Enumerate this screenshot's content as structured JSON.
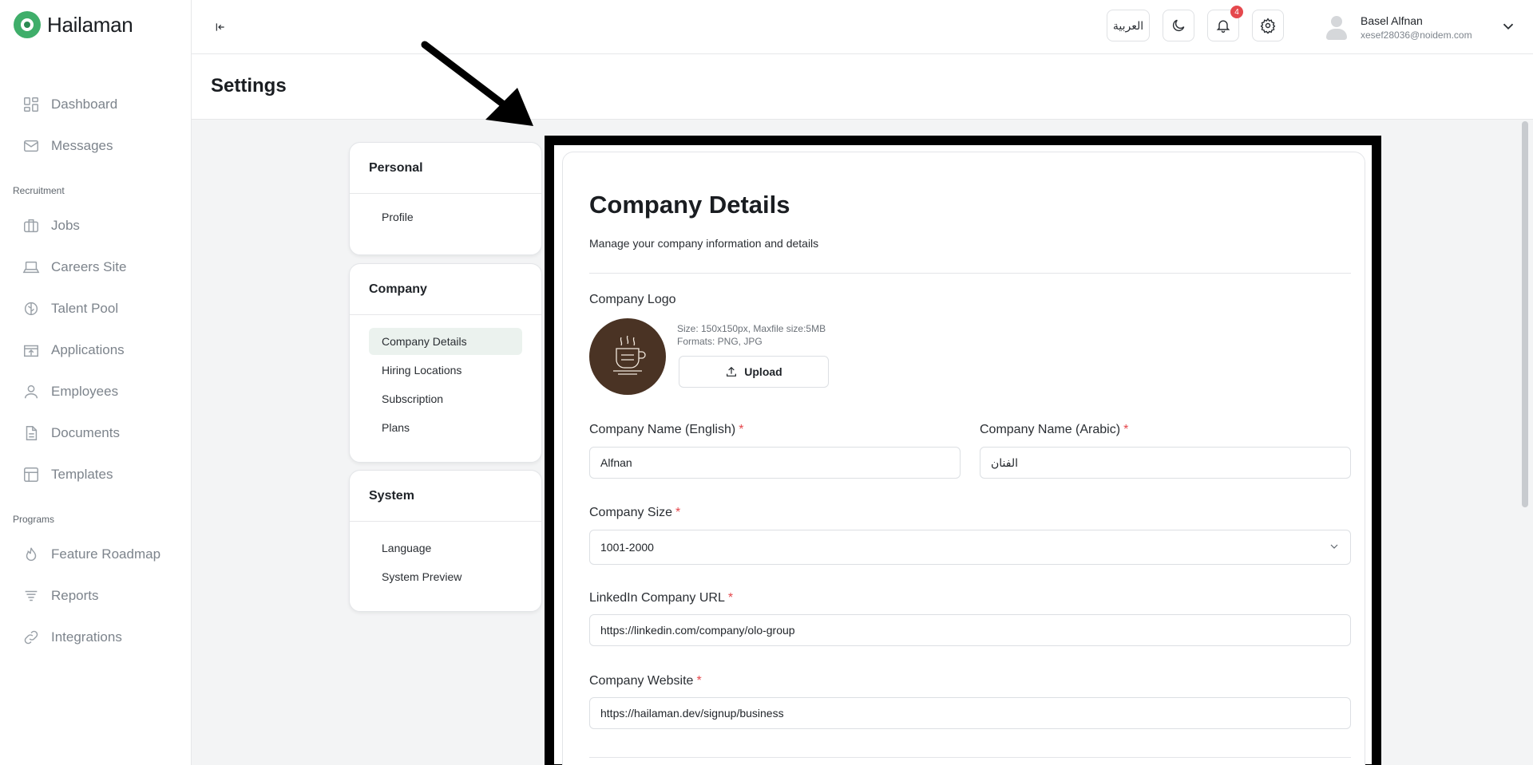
{
  "brand": {
    "name": "Hailaman",
    "accent": "#3fae6a"
  },
  "sidebar": {
    "items_top": [
      {
        "label": "Dashboard",
        "icon": "dashboard-icon"
      },
      {
        "label": "Messages",
        "icon": "mail-icon"
      }
    ],
    "section_recruitment": "Recruitment",
    "items_recruitment": [
      {
        "label": "Jobs",
        "icon": "briefcase-icon"
      },
      {
        "label": "Careers Site",
        "icon": "laptop-icon"
      },
      {
        "label": "Talent Pool",
        "icon": "brain-icon"
      },
      {
        "label": "Applications",
        "icon": "inbox-upload-icon"
      },
      {
        "label": "Employees",
        "icon": "user-icon"
      },
      {
        "label": "Documents",
        "icon": "document-icon"
      },
      {
        "label": "Templates",
        "icon": "layout-icon"
      }
    ],
    "section_programs": "Programs",
    "items_programs": [
      {
        "label": "Feature Roadmap",
        "icon": "flame-icon"
      },
      {
        "label": "Reports",
        "icon": "filter-lines-icon"
      },
      {
        "label": "Integrations",
        "icon": "link-icon"
      }
    ]
  },
  "topbar": {
    "language_label": "العربية",
    "notification_count": "4",
    "user_name": "Basel Alfnan",
    "user_email": "xesef28036@noidem.com"
  },
  "page": {
    "title": "Settings"
  },
  "settings_nav": {
    "personal": {
      "title": "Personal",
      "links": [
        "Profile"
      ]
    },
    "company": {
      "title": "Company",
      "links": [
        "Company Details",
        "Hiring Locations",
        "Subscription",
        "Plans"
      ],
      "active": "Company Details"
    },
    "system": {
      "title": "System",
      "links": [
        "Language",
        "System Preview"
      ]
    }
  },
  "form": {
    "title": "Company Details",
    "subtitle": "Manage your company information and details",
    "logo_label": "Company Logo",
    "logo_hint_size": "Size: 150x150px, Maxfile size:5MB",
    "logo_hint_formats": "Formats: PNG, JPG",
    "upload_label": "Upload",
    "name_en_label": "Company Name (English)",
    "name_en_value": "Alfnan",
    "name_ar_label": "Company Name (Arabic)",
    "name_ar_value": "الفنان",
    "size_label": "Company Size",
    "size_value": "1001-2000",
    "linkedin_label": "LinkedIn Company URL",
    "linkedin_value": "https://linkedin.com/company/olo-group",
    "website_label": "Company Website",
    "website_value": "https://hailaman.dev/signup/business",
    "required_mark": "*"
  }
}
